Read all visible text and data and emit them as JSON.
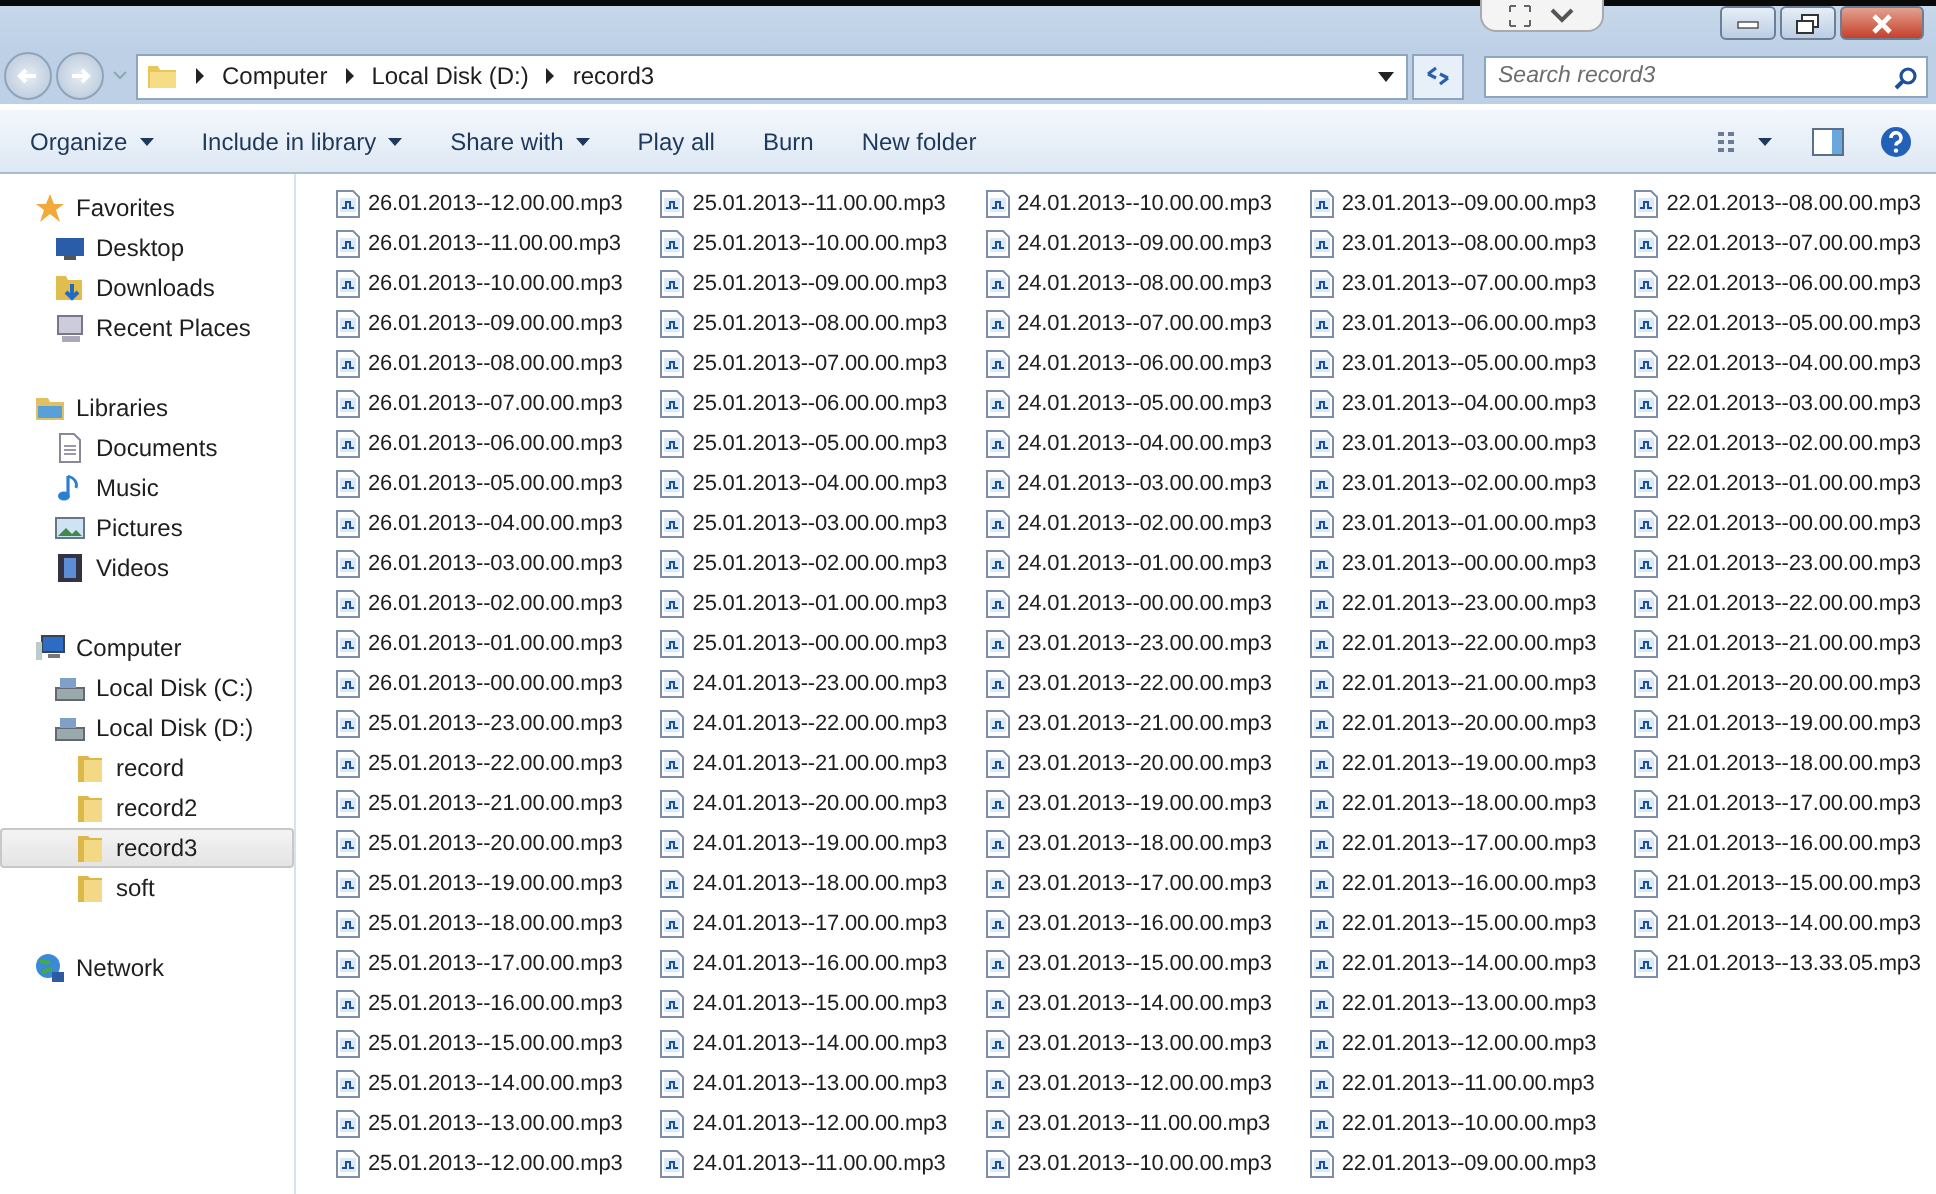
{
  "address": {
    "crumbs": [
      "Computer",
      "Local Disk (D:)",
      "record3"
    ]
  },
  "search": {
    "placeholder": "Search record3"
  },
  "toolbar": [
    {
      "label": "Organize",
      "menu": true
    },
    {
      "label": "Include in library",
      "menu": true
    },
    {
      "label": "Share with",
      "menu": true
    },
    {
      "label": "Play all",
      "menu": false
    },
    {
      "label": "Burn",
      "menu": false
    },
    {
      "label": "New folder",
      "menu": false
    }
  ],
  "nav": [
    {
      "label": "Favorites",
      "kind": "star",
      "selected": false,
      "children": [
        {
          "label": "Desktop",
          "kind": "desktop",
          "selected": false
        },
        {
          "label": "Downloads",
          "kind": "download",
          "selected": false
        },
        {
          "label": "Recent Places",
          "kind": "recent",
          "selected": false
        }
      ]
    },
    {
      "label": "Libraries",
      "kind": "library",
      "selected": false,
      "children": [
        {
          "label": "Documents",
          "kind": "document",
          "selected": false
        },
        {
          "label": "Music",
          "kind": "music",
          "selected": false
        },
        {
          "label": "Pictures",
          "kind": "pictures",
          "selected": false
        },
        {
          "label": "Videos",
          "kind": "videos",
          "selected": false
        }
      ]
    },
    {
      "label": "Computer",
      "kind": "computer",
      "selected": false,
      "children": [
        {
          "label": "Local Disk (C:)",
          "kind": "drive",
          "selected": false
        },
        {
          "label": "Local Disk (D:)",
          "kind": "drive",
          "selected": false,
          "children": [
            {
              "label": "record",
              "kind": "folder",
              "selected": false
            },
            {
              "label": "record2",
              "kind": "folder",
              "selected": false
            },
            {
              "label": "record3",
              "kind": "folder",
              "selected": true
            },
            {
              "label": "soft",
              "kind": "folder",
              "selected": false
            }
          ]
        }
      ]
    },
    {
      "label": "Network",
      "kind": "network",
      "selected": false
    }
  ],
  "files": [
    "26.01.2013--12.00.00.mp3",
    "26.01.2013--11.00.00.mp3",
    "26.01.2013--10.00.00.mp3",
    "26.01.2013--09.00.00.mp3",
    "26.01.2013--08.00.00.mp3",
    "26.01.2013--07.00.00.mp3",
    "26.01.2013--06.00.00.mp3",
    "26.01.2013--05.00.00.mp3",
    "26.01.2013--04.00.00.mp3",
    "26.01.2013--03.00.00.mp3",
    "26.01.2013--02.00.00.mp3",
    "26.01.2013--01.00.00.mp3",
    "26.01.2013--00.00.00.mp3",
    "25.01.2013--23.00.00.mp3",
    "25.01.2013--22.00.00.mp3",
    "25.01.2013--21.00.00.mp3",
    "25.01.2013--20.00.00.mp3",
    "25.01.2013--19.00.00.mp3",
    "25.01.2013--18.00.00.mp3",
    "25.01.2013--17.00.00.mp3",
    "25.01.2013--16.00.00.mp3",
    "25.01.2013--15.00.00.mp3",
    "25.01.2013--14.00.00.mp3",
    "25.01.2013--13.00.00.mp3",
    "25.01.2013--12.00.00.mp3",
    "25.01.2013--11.00.00.mp3",
    "25.01.2013--10.00.00.mp3",
    "25.01.2013--09.00.00.mp3",
    "25.01.2013--08.00.00.mp3",
    "25.01.2013--07.00.00.mp3",
    "25.01.2013--06.00.00.mp3",
    "25.01.2013--05.00.00.mp3",
    "25.01.2013--04.00.00.mp3",
    "25.01.2013--03.00.00.mp3",
    "25.01.2013--02.00.00.mp3",
    "25.01.2013--01.00.00.mp3",
    "25.01.2013--00.00.00.mp3",
    "24.01.2013--23.00.00.mp3",
    "24.01.2013--22.00.00.mp3",
    "24.01.2013--21.00.00.mp3",
    "24.01.2013--20.00.00.mp3",
    "24.01.2013--19.00.00.mp3",
    "24.01.2013--18.00.00.mp3",
    "24.01.2013--17.00.00.mp3",
    "24.01.2013--16.00.00.mp3",
    "24.01.2013--15.00.00.mp3",
    "24.01.2013--14.00.00.mp3",
    "24.01.2013--13.00.00.mp3",
    "24.01.2013--12.00.00.mp3",
    "24.01.2013--11.00.00.mp3",
    "24.01.2013--10.00.00.mp3",
    "24.01.2013--09.00.00.mp3",
    "24.01.2013--08.00.00.mp3",
    "24.01.2013--07.00.00.mp3",
    "24.01.2013--06.00.00.mp3",
    "24.01.2013--05.00.00.mp3",
    "24.01.2013--04.00.00.mp3",
    "24.01.2013--03.00.00.mp3",
    "24.01.2013--02.00.00.mp3",
    "24.01.2013--01.00.00.mp3",
    "24.01.2013--00.00.00.mp3",
    "23.01.2013--23.00.00.mp3",
    "23.01.2013--22.00.00.mp3",
    "23.01.2013--21.00.00.mp3",
    "23.01.2013--20.00.00.mp3",
    "23.01.2013--19.00.00.mp3",
    "23.01.2013--18.00.00.mp3",
    "23.01.2013--17.00.00.mp3",
    "23.01.2013--16.00.00.mp3",
    "23.01.2013--15.00.00.mp3",
    "23.01.2013--14.00.00.mp3",
    "23.01.2013--13.00.00.mp3",
    "23.01.2013--12.00.00.mp3",
    "23.01.2013--11.00.00.mp3",
    "23.01.2013--10.00.00.mp3",
    "23.01.2013--09.00.00.mp3",
    "23.01.2013--08.00.00.mp3",
    "23.01.2013--07.00.00.mp3",
    "23.01.2013--06.00.00.mp3",
    "23.01.2013--05.00.00.mp3",
    "23.01.2013--04.00.00.mp3",
    "23.01.2013--03.00.00.mp3",
    "23.01.2013--02.00.00.mp3",
    "23.01.2013--01.00.00.mp3",
    "23.01.2013--00.00.00.mp3",
    "22.01.2013--23.00.00.mp3",
    "22.01.2013--22.00.00.mp3",
    "22.01.2013--21.00.00.mp3",
    "22.01.2013--20.00.00.mp3",
    "22.01.2013--19.00.00.mp3",
    "22.01.2013--18.00.00.mp3",
    "22.01.2013--17.00.00.mp3",
    "22.01.2013--16.00.00.mp3",
    "22.01.2013--15.00.00.mp3",
    "22.01.2013--14.00.00.mp3",
    "22.01.2013--13.00.00.mp3",
    "22.01.2013--12.00.00.mp3",
    "22.01.2013--11.00.00.mp3",
    "22.01.2013--10.00.00.mp3",
    "22.01.2013--09.00.00.mp3",
    "22.01.2013--08.00.00.mp3",
    "22.01.2013--07.00.00.mp3",
    "22.01.2013--06.00.00.mp3",
    "22.01.2013--05.00.00.mp3",
    "22.01.2013--04.00.00.mp3",
    "22.01.2013--03.00.00.mp3",
    "22.01.2013--02.00.00.mp3",
    "22.01.2013--01.00.00.mp3",
    "22.01.2013--00.00.00.mp3",
    "21.01.2013--23.00.00.mp3",
    "21.01.2013--22.00.00.mp3",
    "21.01.2013--21.00.00.mp3",
    "21.01.2013--20.00.00.mp3",
    "21.01.2013--19.00.00.mp3",
    "21.01.2013--18.00.00.mp3",
    "21.01.2013--17.00.00.mp3",
    "21.01.2013--16.00.00.mp3",
    "21.01.2013--15.00.00.mp3",
    "21.01.2013--14.00.00.mp3",
    "21.01.2013--13.33.05.mp3"
  ]
}
